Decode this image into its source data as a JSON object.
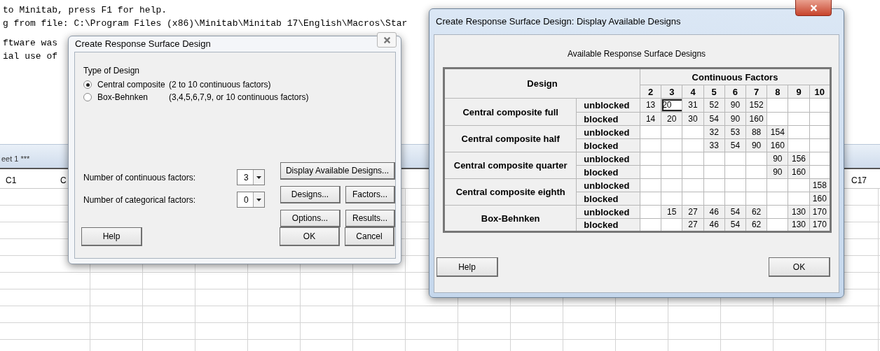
{
  "session": {
    "paragraphs": [
      [
        "to Minitab, press F1 for help.",
        "g from file: C:\\Program Files (x86)\\Minitab\\Minitab 17\\English\\Macros\\Star"
      ],
      [
        "ftware was",
        "ial use of"
      ]
    ]
  },
  "worksheet": {
    "title": "eet 1 ***",
    "columns": [
      "C1",
      "C",
      "C17"
    ]
  },
  "create_dialog": {
    "title": "Create Response Surface Design",
    "group_label": "Type of Design",
    "design_types": [
      {
        "label": "Central composite",
        "note": "(2 to 10 continuous factors)",
        "selected": true
      },
      {
        "label": "Box-Behnken",
        "note": "(3,4,5,6,7,9, or 10 continuous factors)",
        "selected": false
      }
    ],
    "fields": [
      {
        "label": "Number of continuous factors:",
        "value": "3"
      },
      {
        "label": "Number of categorical factors:",
        "value": "0"
      }
    ],
    "buttons": [
      "Display Available Designs...",
      "Designs...",
      "Factors...",
      "Options...",
      "Results..."
    ],
    "footer_buttons": [
      "Help",
      "OK",
      "Cancel"
    ]
  },
  "designs_dialog": {
    "title": "Create Response Surface Design: Display Available Designs",
    "heading": "Available Response Surface Designs",
    "table": {
      "design_header": "Design",
      "factors_header": "Continuous Factors",
      "factor_counts": [
        "2",
        "3",
        "4",
        "5",
        "6",
        "7",
        "8",
        "9",
        "10"
      ],
      "designs": [
        {
          "name": "Central composite full",
          "rows": [
            {
              "label": "unblocked",
              "cells": [
                {
                  "text": "13",
                  "selected": false
                },
                {
                  "text": "20",
                  "selected": true
                },
                {
                  "text": "31",
                  "selected": false
                },
                {
                  "text": "52",
                  "selected": false
                },
                {
                  "text": "90",
                  "selected": false
                },
                {
                  "text": "152",
                  "selected": false
                },
                null,
                null,
                null
              ]
            },
            {
              "label": "blocked",
              "cells": [
                {
                  "text": "14",
                  "selected": false
                },
                {
                  "text": "20",
                  "selected": false
                },
                {
                  "text": "30",
                  "selected": false
                },
                {
                  "text": "54",
                  "selected": false
                },
                {
                  "text": "90",
                  "selected": false
                },
                {
                  "text": "160",
                  "selected": false
                },
                null,
                null,
                null
              ]
            }
          ]
        },
        {
          "name": "Central composite half",
          "rows": [
            {
              "label": "unblocked",
              "cells": [
                null,
                null,
                null,
                {
                  "text": "32",
                  "selected": false
                },
                {
                  "text": "53",
                  "selected": false
                },
                {
                  "text": "88",
                  "selected": false
                },
                {
                  "text": "154",
                  "selected": false
                },
                null,
                null
              ]
            },
            {
              "label": "blocked",
              "cells": [
                null,
                null,
                null,
                {
                  "text": "33",
                  "selected": false
                },
                {
                  "text": "54",
                  "selected": false
                },
                {
                  "text": "90",
                  "selected": false
                },
                {
                  "text": "160",
                  "selected": false
                },
                null,
                null
              ]
            }
          ]
        },
        {
          "name": "Central composite quarter",
          "rows": [
            {
              "label": "unblocked",
              "cells": [
                null,
                null,
                null,
                null,
                null,
                null,
                {
                  "text": "90",
                  "selected": false
                },
                {
                  "text": "156",
                  "selected": false
                },
                null
              ]
            },
            {
              "label": "blocked",
              "cells": [
                null,
                null,
                null,
                null,
                null,
                null,
                {
                  "text": "90",
                  "selected": false
                },
                {
                  "text": "160",
                  "selected": false
                },
                null
              ]
            }
          ]
        },
        {
          "name": "Central composite eighth",
          "rows": [
            {
              "label": "unblocked",
              "cells": [
                null,
                null,
                null,
                null,
                null,
                null,
                null,
                null,
                {
                  "text": "158",
                  "selected": false
                }
              ]
            },
            {
              "label": "blocked",
              "cells": [
                null,
                null,
                null,
                null,
                null,
                null,
                null,
                null,
                {
                  "text": "160",
                  "selected": false
                }
              ]
            }
          ]
        },
        {
          "name": "Box-Behnken",
          "rows": [
            {
              "label": "unblocked",
              "cells": [
                null,
                {
                  "text": "15",
                  "selected": false
                },
                {
                  "text": "27",
                  "selected": false
                },
                {
                  "text": "46",
                  "selected": false
                },
                {
                  "text": "54",
                  "selected": false
                },
                {
                  "text": "62",
                  "selected": false
                },
                null,
                {
                  "text": "130",
                  "selected": false
                },
                {
                  "text": "170",
                  "selected": false
                }
              ]
            },
            {
              "label": "blocked",
              "cells": [
                null,
                null,
                {
                  "text": "27",
                  "selected": false
                },
                {
                  "text": "46",
                  "selected": false
                },
                {
                  "text": "54",
                  "selected": false
                },
                {
                  "text": "62",
                  "selected": false
                },
                null,
                {
                  "text": "130",
                  "selected": false
                },
                {
                  "text": "170",
                  "selected": false
                }
              ]
            }
          ]
        }
      ]
    },
    "buttons": [
      "Help",
      "OK"
    ]
  }
}
